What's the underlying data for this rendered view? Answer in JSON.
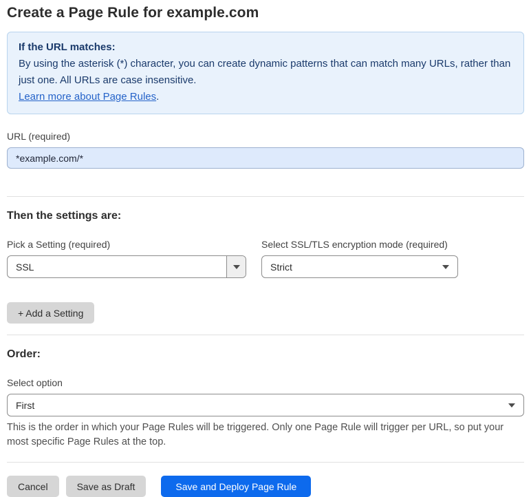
{
  "page": {
    "title": "Create a Page Rule for example.com"
  },
  "info_box": {
    "heading": "If the URL matches:",
    "body": "By using the asterisk (*) character, you can create dynamic patterns that can match many URLs, rather than just one. All URLs are case insensitive.",
    "link_label": "Learn more about Page Rules",
    "link_suffix": "."
  },
  "url_field": {
    "label": "URL (required)",
    "value": "*example.com/*"
  },
  "settings_section": {
    "heading": "Then the settings are:",
    "setting_picker": {
      "label": "Pick a Setting (required)",
      "value": "SSL"
    },
    "ssl_mode_picker": {
      "label": "Select SSL/TLS encryption mode (required)",
      "value": "Strict"
    },
    "add_setting_label": "+ Add a Setting"
  },
  "order_section": {
    "heading": "Order:",
    "select_label": "Select option",
    "value": "First",
    "help_text": "This is the order in which your Page Rules will be triggered. Only one Page Rule will trigger per URL, so put your most specific Page Rules at the top."
  },
  "footer": {
    "cancel_label": "Cancel",
    "save_draft_label": "Save as Draft",
    "save_deploy_label": "Save and Deploy Page Rule"
  },
  "colors": {
    "accent_blue": "#0d6aed",
    "info_bg": "#e9f2fc",
    "info_border": "#b8d4ee",
    "info_text": "#1a3a6b",
    "link_blue": "#2563c9",
    "url_input_bg": "#deeafc",
    "button_gray": "#d6d6d6",
    "divider": "#e0e0e0"
  },
  "icons": {
    "dropdown_arrow": "caret-down"
  }
}
